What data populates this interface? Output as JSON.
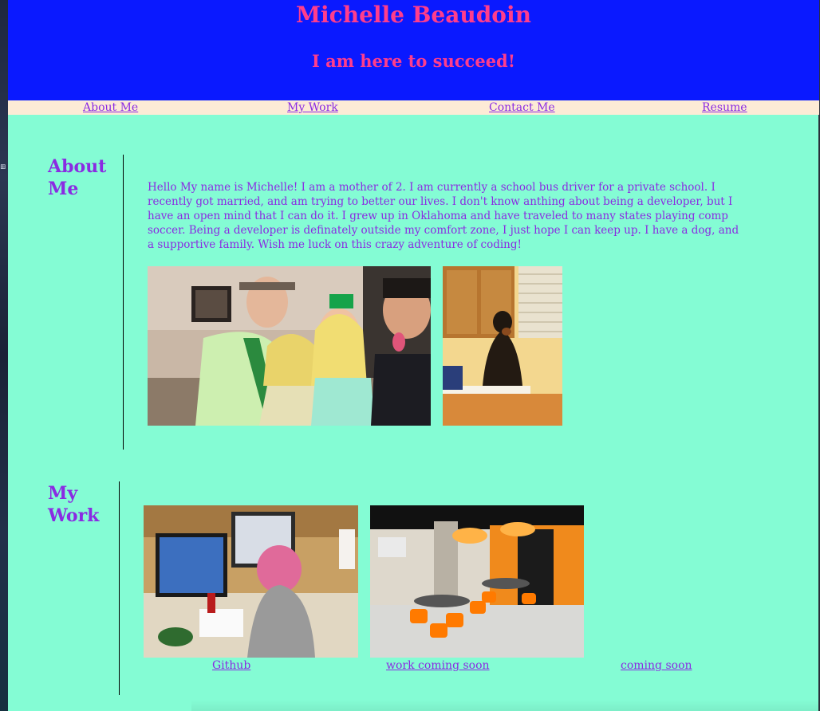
{
  "header": {
    "title": "Michelle Beaudoin",
    "tagline": "I am here to succeed!"
  },
  "nav": {
    "items": [
      {
        "label": "About Me"
      },
      {
        "label": "My Work"
      },
      {
        "label": "Contact Me"
      },
      {
        "label": "Resume"
      }
    ]
  },
  "about": {
    "heading": "About Me",
    "text": "Hello My name is Michelle! I am a mother of 2. I am currently a school bus driver for a private school. I recently got married, and am trying to better our lives. I don't know anthing about being a developer, but I have an open mind that I can do it. I grew up in Oklahoma and have traveled to many states playing comp soccer. Being a developer is definately outside my comfort zone, I just hope I can keep up. I have a dog, and a supportive family. Wish me luck on this crazy adventure of coding!"
  },
  "work": {
    "heading": "My Work",
    "links": [
      {
        "label": "Github"
      },
      {
        "label": "work coming soon"
      },
      {
        "label": "coming soon"
      }
    ]
  },
  "colors": {
    "page_bg": "#84fcd4",
    "header_bg": "#0a19ff",
    "title_color": "#ff3d8c",
    "nav_bg": "#fdebd6",
    "accent": "#8a2be2"
  }
}
